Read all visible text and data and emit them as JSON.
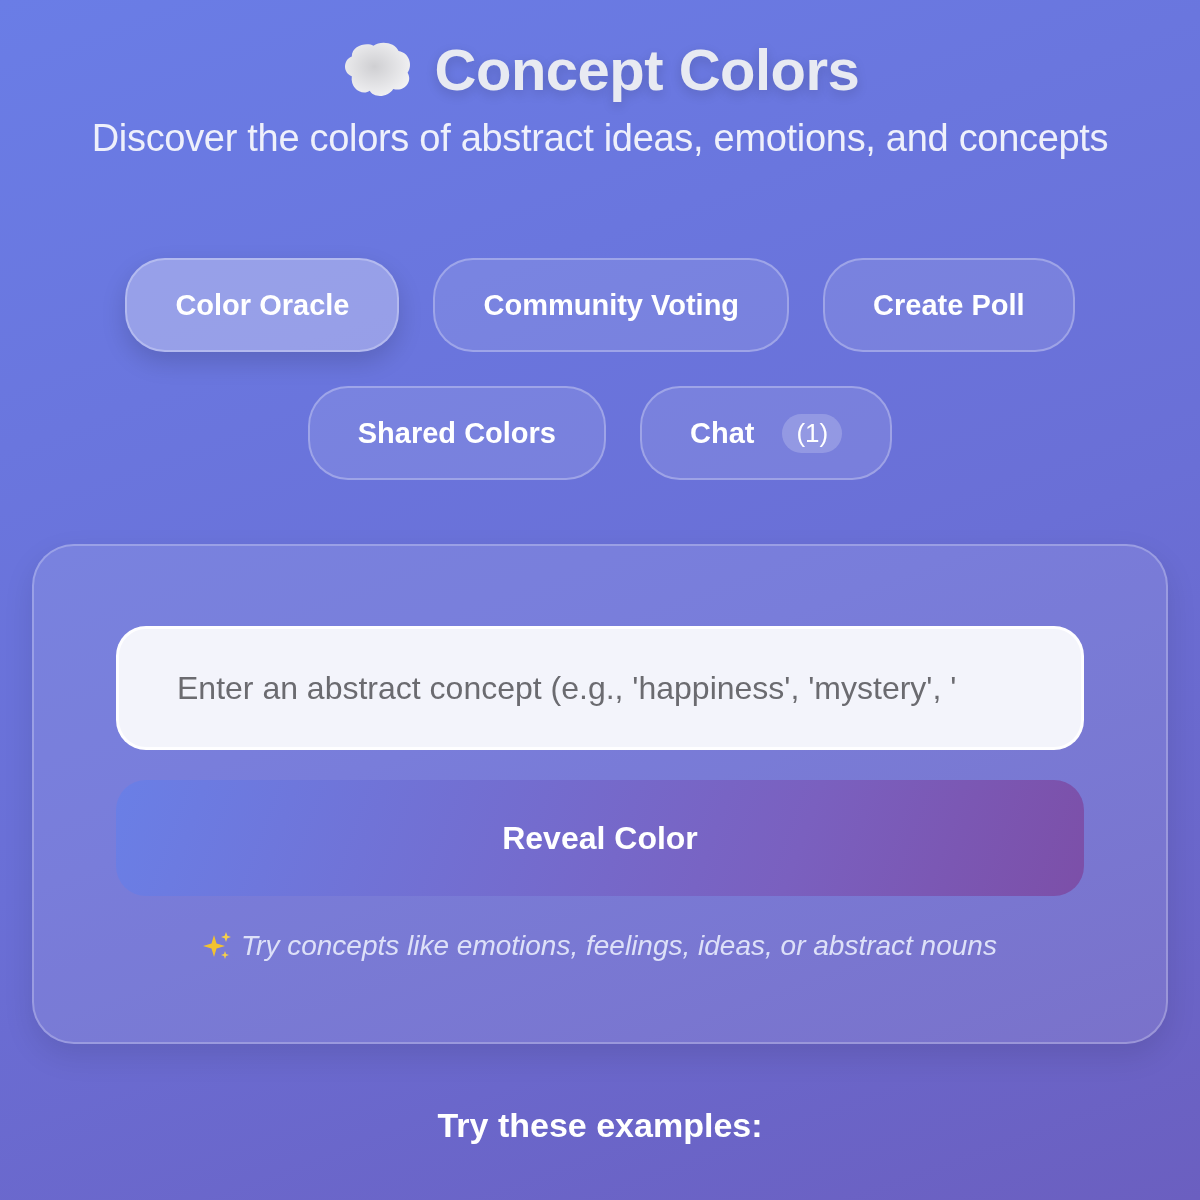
{
  "header": {
    "title": "Concept Colors",
    "subtitle": "Discover the colors of abstract ideas, emotions, and concepts"
  },
  "tabs": [
    {
      "label": "Color Oracle",
      "selected": true
    },
    {
      "label": "Community Voting",
      "selected": false
    },
    {
      "label": "Create Poll",
      "selected": false
    },
    {
      "label": "Shared Colors",
      "selected": false
    },
    {
      "label": "Chat",
      "selected": false,
      "badge": "(1)"
    }
  ],
  "oracle": {
    "input": {
      "placeholder": "Enter an abstract concept (e.g., 'happiness', 'mystery', '"
    },
    "button": "Reveal Color",
    "hint": "Try concepts like emotions, feelings, ideas, or abstract nouns"
  },
  "examples": {
    "heading": "Try these examples:"
  }
}
